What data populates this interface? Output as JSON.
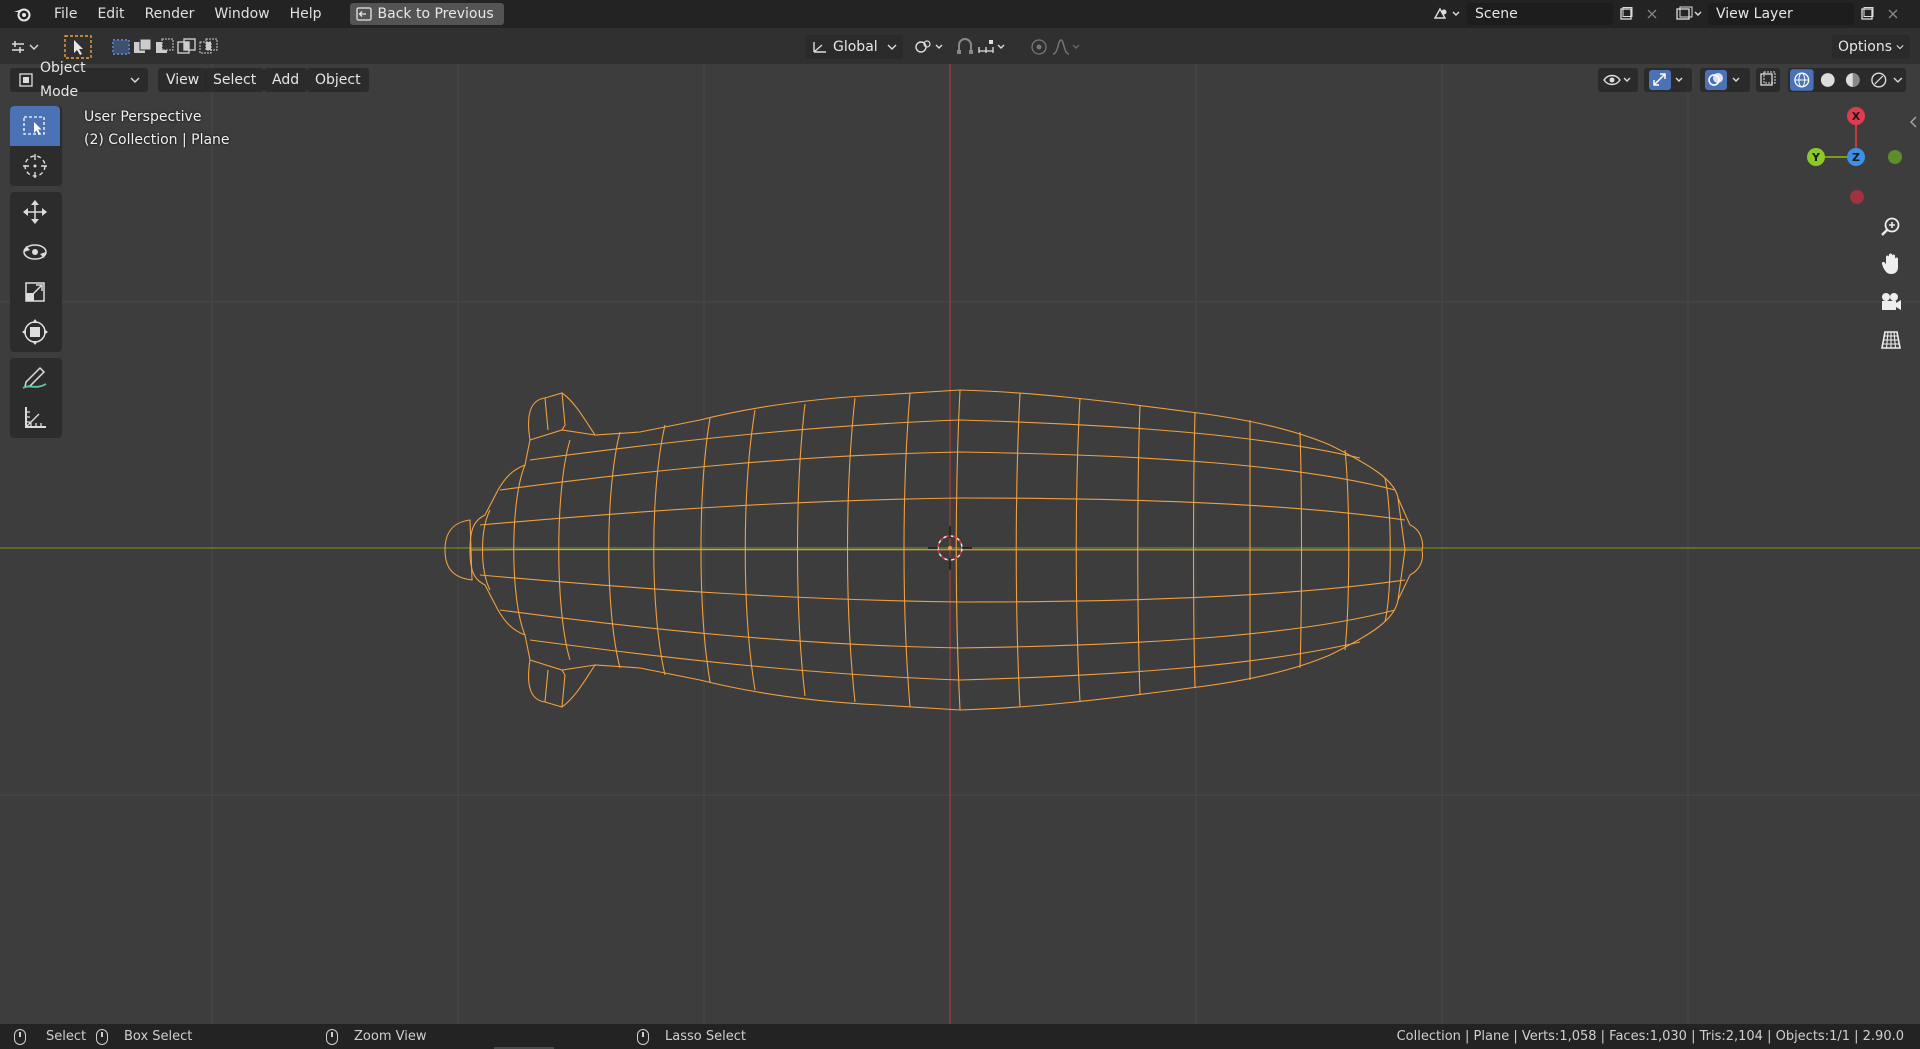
{
  "menu": {
    "file": "File",
    "edit": "Edit",
    "render": "Render",
    "window": "Window",
    "help": "Help",
    "back_to_previous": "Back to Previous"
  },
  "scene": {
    "name": "Scene"
  },
  "view_layer": {
    "name": "View Layer"
  },
  "tool_header": {
    "orientation": "Global",
    "options": "Options"
  },
  "viewport_header": {
    "mode": "Object Mode",
    "view": "View",
    "select": "Select",
    "add": "Add",
    "object": "Object"
  },
  "overlay": {
    "perspective": "User Perspective",
    "collection": "(2) Collection | Plane"
  },
  "gizmo": {
    "x": "X",
    "y": "Y",
    "z": "Z"
  },
  "statusbar": {
    "select": "Select",
    "box_select": "Box Select",
    "zoom_view": "Zoom View",
    "lasso_select": "Lasso Select",
    "stats": "Collection | Plane | Verts:1,058 | Faces:1,030 | Tris:2,104 | Objects:1/1 | 2.90.0"
  },
  "colors": {
    "wire": "#f0a040",
    "x_axis": "#c43c3c",
    "y_axis": "#7a9a22",
    "accent": "#4a72b5"
  }
}
